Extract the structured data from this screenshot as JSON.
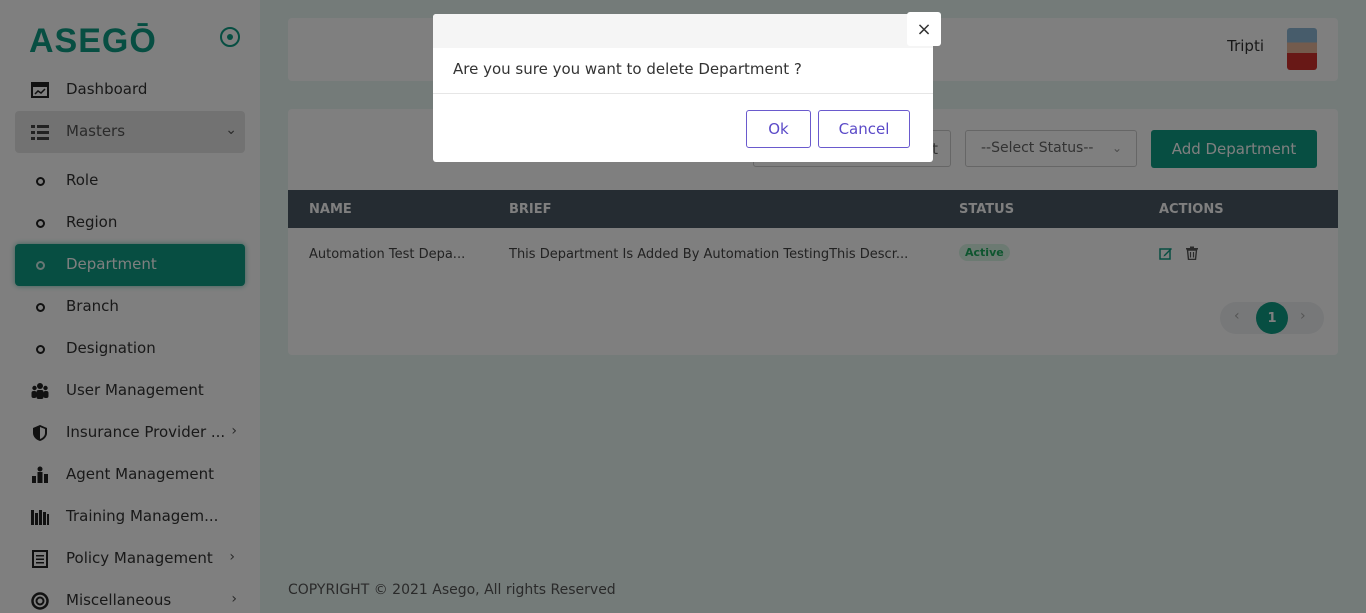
{
  "app": {
    "logo_text": "ASEGŌ",
    "brand_color": "#0f9c84"
  },
  "sidebar": {
    "items": [
      {
        "label": "Dashboard",
        "icon": "dashboard-icon"
      },
      {
        "label": "Masters",
        "icon": "list-icon",
        "expanded": true
      },
      {
        "label": "Role",
        "icon": "dot-icon"
      },
      {
        "label": "Region",
        "icon": "dot-icon"
      },
      {
        "label": "Department",
        "icon": "dot-icon",
        "active": true
      },
      {
        "label": "Branch",
        "icon": "dot-icon"
      },
      {
        "label": "Designation",
        "icon": "dot-icon"
      },
      {
        "label": "User Management",
        "icon": "users-icon"
      },
      {
        "label": "Insurance Provider ...",
        "icon": "shield-icon"
      },
      {
        "label": "Agent Management",
        "icon": "agent-icon"
      },
      {
        "label": "Training Managem...",
        "icon": "books-icon"
      },
      {
        "label": "Policy Management",
        "icon": "document-icon"
      },
      {
        "label": "Miscellaneous",
        "icon": "lifebuoy-icon"
      }
    ]
  },
  "header": {
    "user_name": "Tripti"
  },
  "toolbar": {
    "search_placeholder_fragment": "t",
    "status_select": "--Select Status--",
    "add_label": "Add Department"
  },
  "table": {
    "columns": [
      "NAME",
      "BRIEF",
      "STATUS",
      "ACTIONS"
    ],
    "rows": [
      {
        "name": "Automation Test Depa...",
        "brief": "This Department Is Added By Automation TestingThis Descr...",
        "status": "Active"
      }
    ]
  },
  "pagination": {
    "current_page": "1",
    "prev": "‹",
    "next": "›"
  },
  "footer": {
    "copyright": "COPYRIGHT © 2021 Asego, All rights Reserved"
  },
  "modal": {
    "message": "Are you sure you want to delete Department ?",
    "ok_label": "Ok",
    "cancel_label": "Cancel",
    "close_label": "×"
  }
}
